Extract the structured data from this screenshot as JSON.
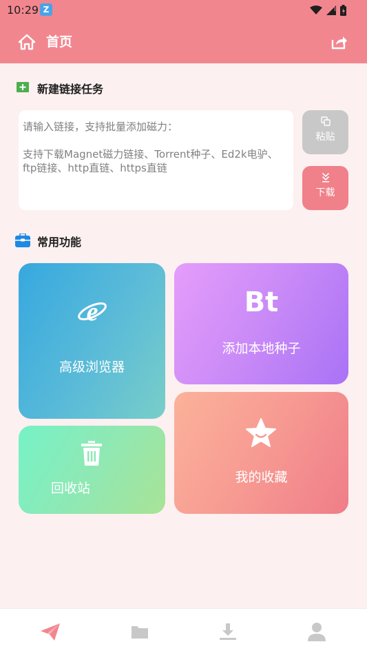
{
  "status_bar": {
    "time": "10:29",
    "app_icon_glyph": "Z"
  },
  "header": {
    "title": "首页",
    "home_icon": "home-icon",
    "share_icon": "share-icon"
  },
  "new_task": {
    "title": "新建链接任务",
    "icon": "plus-square-icon",
    "placeholder_lines": [
      "请输入链接，支持批量添加磁力：",
      "",
      "支持下载Magnet磁力链接、Torrent种子、Ed2k电驴、",
      "ftp链接、http直链、https直链"
    ],
    "paste_label": "粘贴",
    "download_label": "下载"
  },
  "functions": {
    "title": "常用功能",
    "icon": "toolbox-icon",
    "browser_label": "高级浏览器",
    "bt_glyph": "Bt",
    "bt_label": "添加本地种子",
    "recycle_label": "回收站",
    "favorites_label": "我的收藏"
  },
  "bottom_nav": {
    "items": [
      "send-icon",
      "folder-icon",
      "download-icon",
      "user-icon"
    ],
    "active_index": 0
  },
  "colors": {
    "primary": "#f2868f",
    "background": "#fdf0f0",
    "icon_inactive": "#c8c8c8"
  }
}
